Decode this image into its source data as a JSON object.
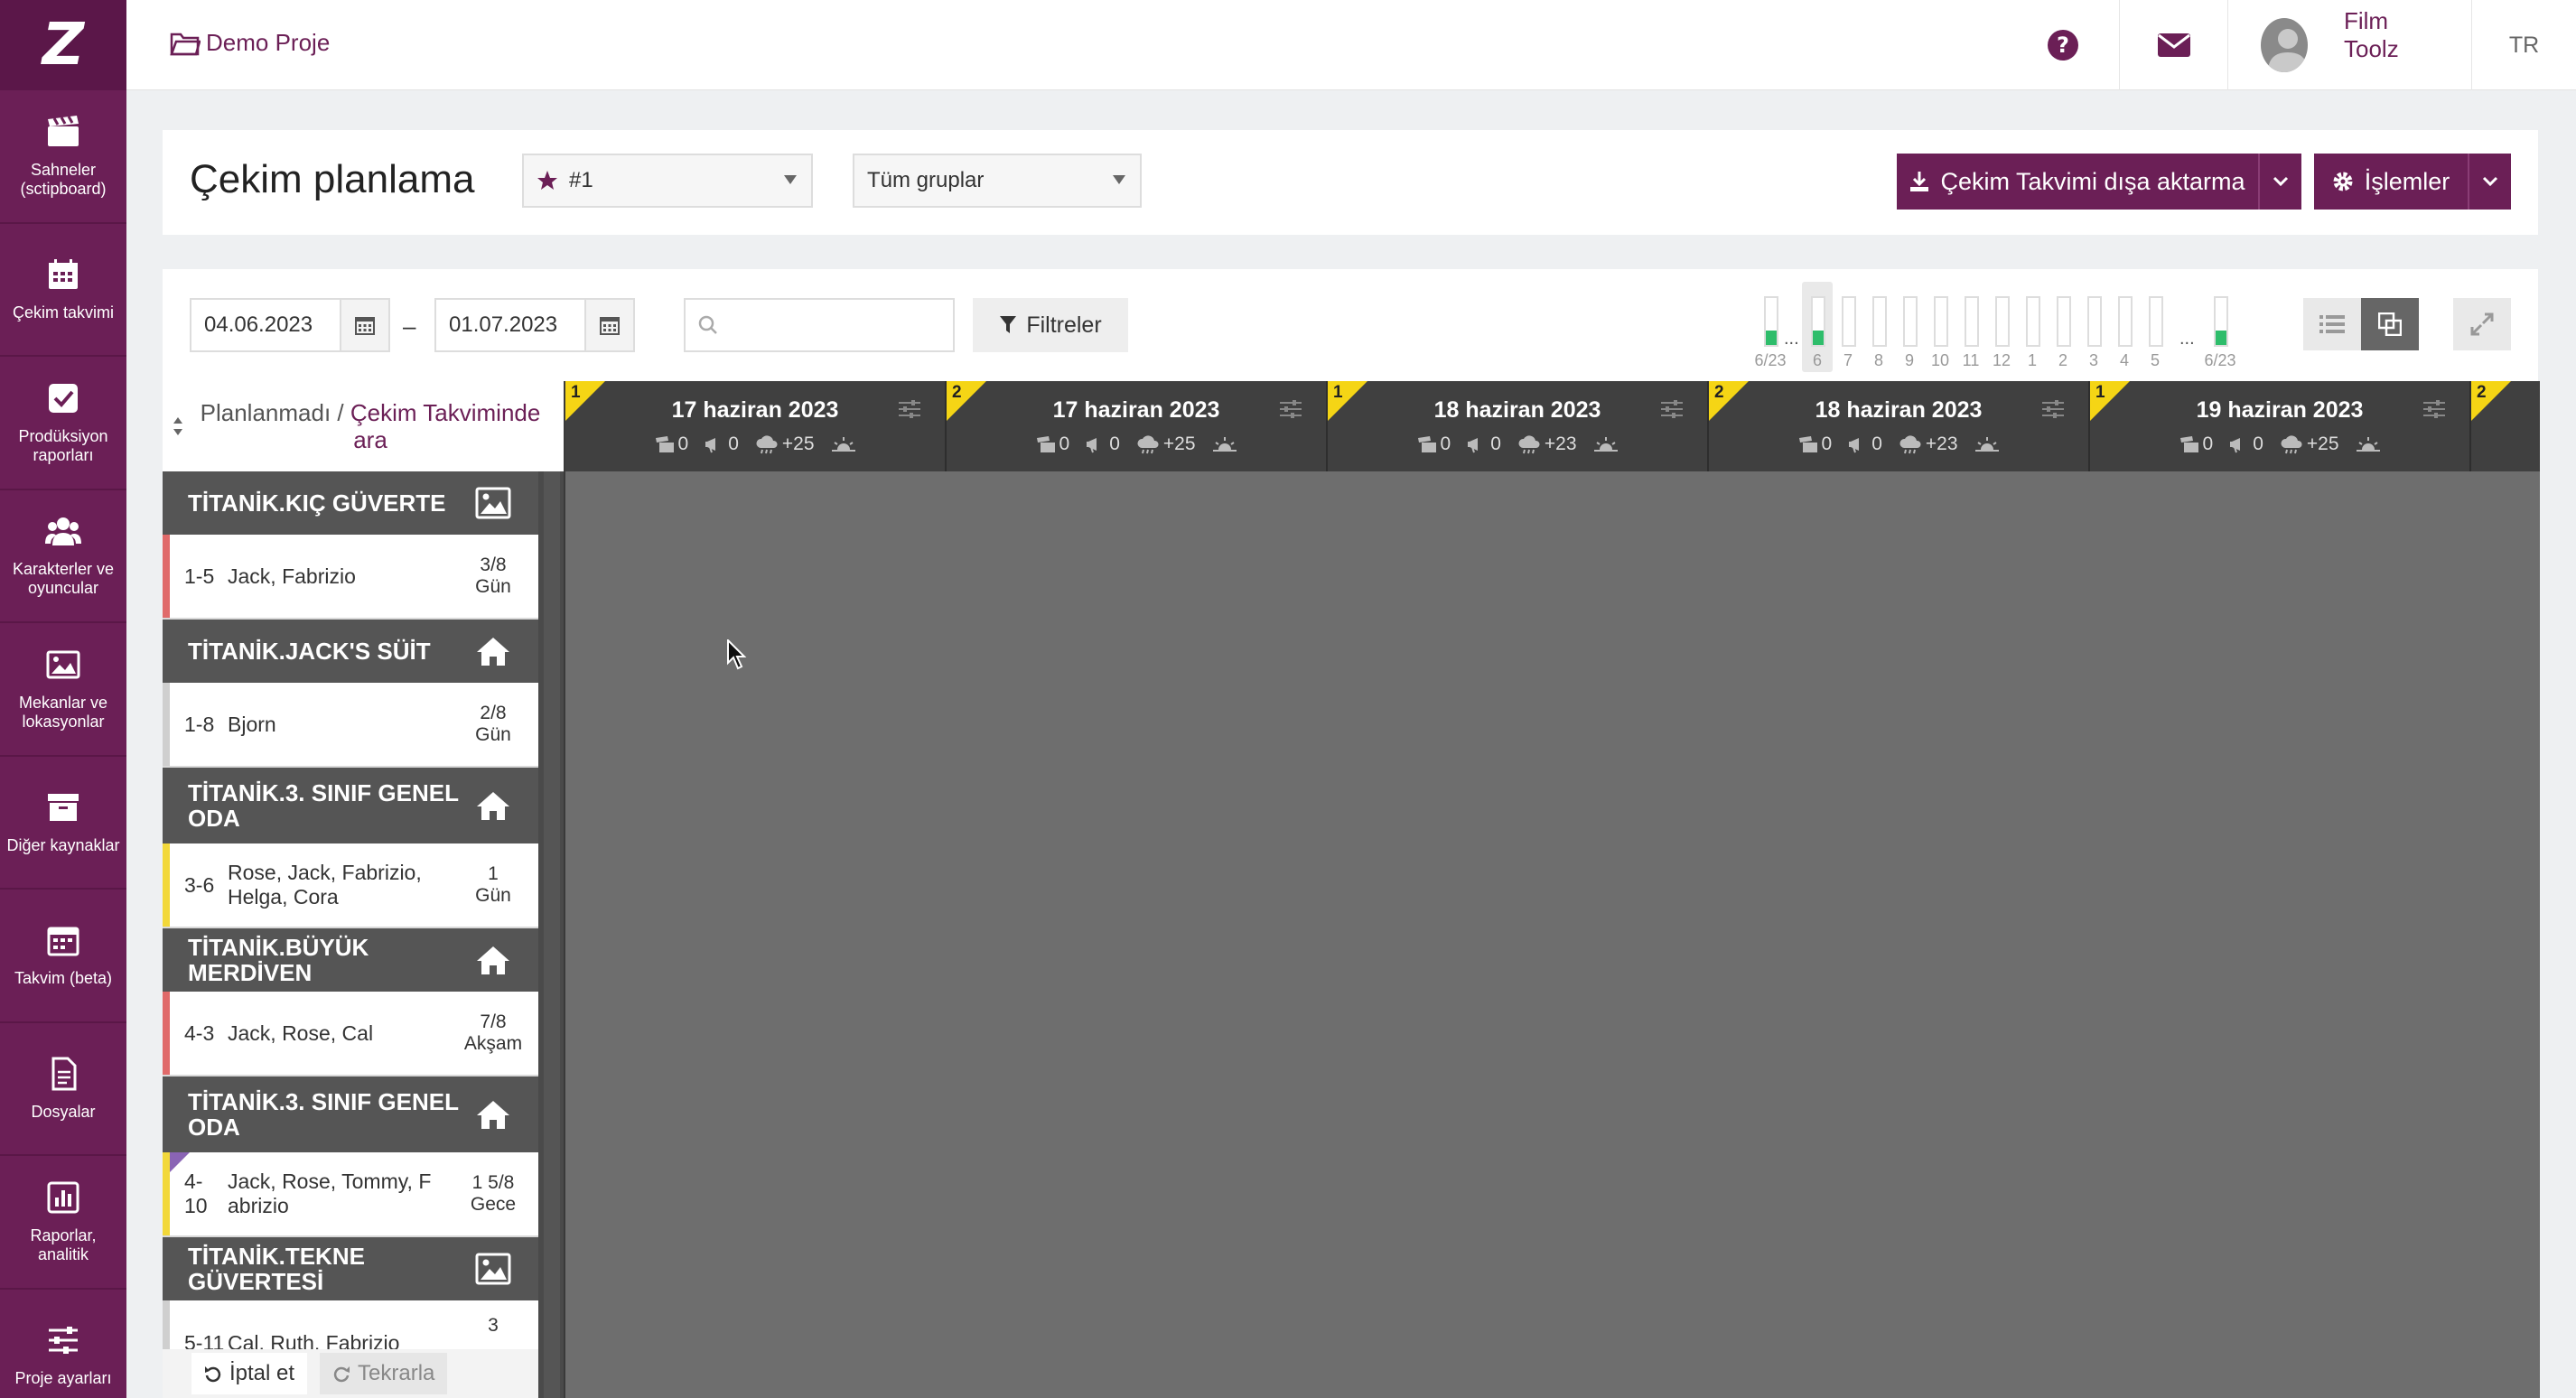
{
  "sidebar": {
    "logo": "Z",
    "items": [
      {
        "label": "Sahneler (sctipboard)",
        "icon": "clapperboard-icon"
      },
      {
        "label": "Çekim takvimi",
        "icon": "calendar-icon"
      },
      {
        "label": "Prodüksiyon raporları",
        "icon": "checkbox-icon"
      },
      {
        "label": "Karakterler ve oyuncular",
        "icon": "users-icon"
      },
      {
        "label": "Mekanlar ve lokasyonlar",
        "icon": "image-icon"
      },
      {
        "label": "Diğer kaynaklar",
        "icon": "archive-icon"
      },
      {
        "label": "Takvim (beta)",
        "icon": "calendar-beta-icon"
      },
      {
        "label": "Dosyalar",
        "icon": "file-icon"
      },
      {
        "label": "Raporlar, analitik",
        "icon": "bar-chart-icon"
      },
      {
        "label": "Proje ayarları",
        "icon": "sliders-icon"
      }
    ]
  },
  "topbar": {
    "project": "Demo Proje",
    "user": "Film Toolz",
    "lang": "TR"
  },
  "titlecard": {
    "title": "Çekim planlama",
    "schedule_select": "#1",
    "group_select": "Tüm gruplar",
    "export_label": "Çekim Takvimi dışa aktarma",
    "actions_label": "İşlemler"
  },
  "toolbar": {
    "date_from": "04.06.2023",
    "date_to": "01.07.2023",
    "dash": "–",
    "search_placeholder": "",
    "filter_label": "Filtreler",
    "mini_days": [
      {
        "label": "6/23",
        "fill": 0.3,
        "selected": false
      },
      {
        "label": "6",
        "fill": 0.3,
        "selected": true
      },
      {
        "label": "7",
        "fill": 0,
        "selected": false
      },
      {
        "label": "8",
        "fill": 0,
        "selected": false
      },
      {
        "label": "9",
        "fill": 0,
        "selected": false
      },
      {
        "label": "10",
        "fill": 0,
        "selected": false
      },
      {
        "label": "11",
        "fill": 0,
        "selected": false
      },
      {
        "label": "12",
        "fill": 0,
        "selected": false
      },
      {
        "label": "1",
        "fill": 0,
        "selected": false
      },
      {
        "label": "2",
        "fill": 0,
        "selected": false
      },
      {
        "label": "3",
        "fill": 0,
        "selected": false
      },
      {
        "label": "4",
        "fill": 0,
        "selected": false
      },
      {
        "label": "5",
        "fill": 0,
        "selected": false
      },
      {
        "label": "6/23",
        "fill": 0.3,
        "selected": false
      }
    ],
    "dots": "..."
  },
  "left_panel": {
    "header_plain": "Planlanmadı /",
    "header_link": "Çekim Takviminde ara",
    "groups": [
      {
        "location": "TİTANİK.KIÇ GÜVERTE",
        "icon": "image-icon",
        "scene": {
          "num": "1-5",
          "chars": "Jack, Fabrizio",
          "dur_top": "3/8",
          "dur_bottom": "Gün",
          "stripe": "#e06a6a"
        }
      },
      {
        "location": "TİTANİK.JACK'S SÜİT",
        "icon": "home-icon",
        "scene": {
          "num": "1-8",
          "chars": "Bjorn",
          "dur_top": "2/8",
          "dur_bottom": "Gün",
          "stripe": "#cfcfcf"
        }
      },
      {
        "location": "TİTANİK.3. SINIF GENEL ODA",
        "icon": "home-icon",
        "scene": {
          "num": "3-6",
          "chars": "Rose, Jack, Fabrizio, Helga, Cora",
          "dur_top": "1",
          "dur_bottom": "Gün",
          "stripe": "#f2d83a"
        }
      },
      {
        "location": "TİTANİK.BÜYÜK MERDİVEN",
        "icon": "home-icon",
        "scene": {
          "num": "4-3",
          "chars": "Jack, Rose, Cal",
          "dur_top": "7/8",
          "dur_bottom": "Akşam",
          "stripe": "#e06a6a"
        }
      },
      {
        "location": "TİTANİK.3. SINIF GENEL ODA",
        "icon": "home-icon",
        "scene": {
          "num": "4-10",
          "chars": "Jack, Rose, Tommy, F abrizio",
          "dur_top": "1 5/8",
          "dur_bottom": "Gece",
          "stripe": "#f2d83a"
        }
      },
      {
        "location": "TİTANİK.TEKNE GÜVERTESİ",
        "icon": "image-icon",
        "scene": {
          "num": "5-11",
          "chars": "Cal, Ruth, Fabrizio",
          "dur_top": "3",
          "dur_bottom": "",
          "stripe": "#cfcfcf"
        }
      }
    ],
    "undo_label": "İptal et",
    "redo_label": "Tekrarla"
  },
  "board": {
    "days": [
      {
        "num": "1",
        "date": "17 haziran 2023",
        "a": "0",
        "b": "0",
        "temp": "+25"
      },
      {
        "num": "2",
        "date": "17 haziran 2023",
        "a": "0",
        "b": "0",
        "temp": "+25"
      },
      {
        "num": "1",
        "date": "18 haziran 2023",
        "a": "0",
        "b": "0",
        "temp": "+23"
      },
      {
        "num": "2",
        "date": "18 haziran 2023",
        "a": "0",
        "b": "0",
        "temp": "+23"
      },
      {
        "num": "1",
        "date": "19 haziran 2023",
        "a": "0",
        "b": "0",
        "temp": "+25"
      },
      {
        "num": "2",
        "date": "",
        "a": "",
        "b": "",
        "temp": ""
      }
    ]
  },
  "colors": {
    "brand": "#6b1f56",
    "accent_yellow": "#f5d515",
    "green": "#2ebd6b"
  }
}
